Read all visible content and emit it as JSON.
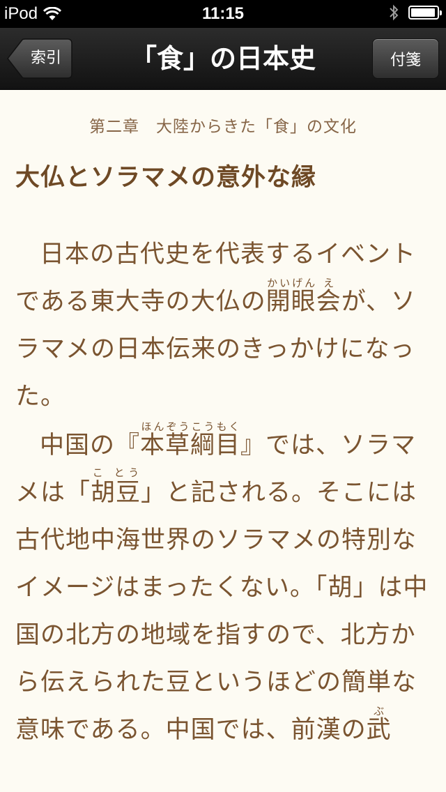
{
  "status_bar": {
    "carrier": "iPod",
    "time": "11:15",
    "battery_level": 0.95
  },
  "nav": {
    "back_label": "索引",
    "title": "「食」の日本史",
    "bookmark_label": "付箋"
  },
  "content": {
    "chapter": "第二章　大陸からきた「食」の文化",
    "section_title": "大仏とソラマメの意外な縁",
    "p1": {
      "t1": "日本の古代史を代表するイベントである東大寺の大仏の",
      "r1": {
        "base": "開眼",
        "ruby": "かいげん"
      },
      "r2": {
        "base": "会",
        "ruby": "え"
      },
      "t2": "が、ソラマメの日本伝来のきっかけになった。"
    },
    "p2": {
      "t1": "中国の『",
      "r1": {
        "base": "本草綱目",
        "ruby": "ほんぞうこうもく"
      },
      "t2": "』では、ソラマメは「",
      "r2": {
        "base": "胡豆",
        "ruby": "こ とう"
      },
      "t3": "」と記される。そこには古代地中海世界のソラマメの特別なイメージはまったくない。「胡」は中国の北方の地域を指すので、北方から伝えられた豆というほどの簡単な意味である。中国では、前漢の",
      "r3": {
        "base": "武",
        "ruby": "ぶ"
      }
    }
  }
}
